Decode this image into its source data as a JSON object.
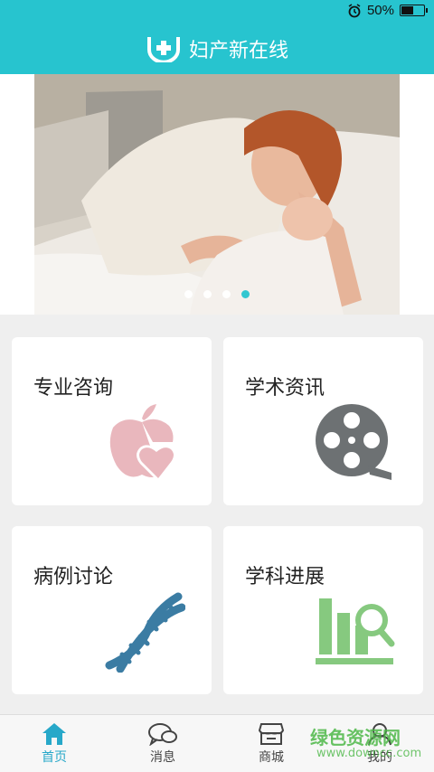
{
  "status_bar": {
    "battery_percent": "50%",
    "battery_level": 0.5,
    "alarm_icon": "alarm-clock-icon"
  },
  "header": {
    "title": "妇产新在线",
    "logo_icon": "medical-cross-logo-icon"
  },
  "banner": {
    "slide_count": 4,
    "active_slide": 4
  },
  "cards": [
    {
      "label": "专业咨询",
      "icon": "apple-heart-icon",
      "color": "#e9b7bd"
    },
    {
      "label": "学术资讯",
      "icon": "film-reel-icon",
      "color": "#6d7173"
    },
    {
      "label": "病例讨论",
      "icon": "dna-icon",
      "color": "#3b7ca3"
    },
    {
      "label": "学科进展",
      "icon": "bar-chart-magnifier-icon",
      "color": "#86c97f"
    }
  ],
  "tabs": [
    {
      "label": "首页",
      "icon": "home-icon",
      "active": true
    },
    {
      "label": "消息",
      "icon": "chat-bubbles-icon",
      "active": false
    },
    {
      "label": "商城",
      "icon": "store-icon",
      "active": false
    },
    {
      "label": "我的",
      "icon": "user-icon",
      "active": false
    }
  ],
  "watermark": {
    "text": "绿色资源网",
    "url": "www.downcc.com"
  },
  "colors": {
    "brand": "#27c4cf",
    "tab_active": "#27a8c9"
  }
}
